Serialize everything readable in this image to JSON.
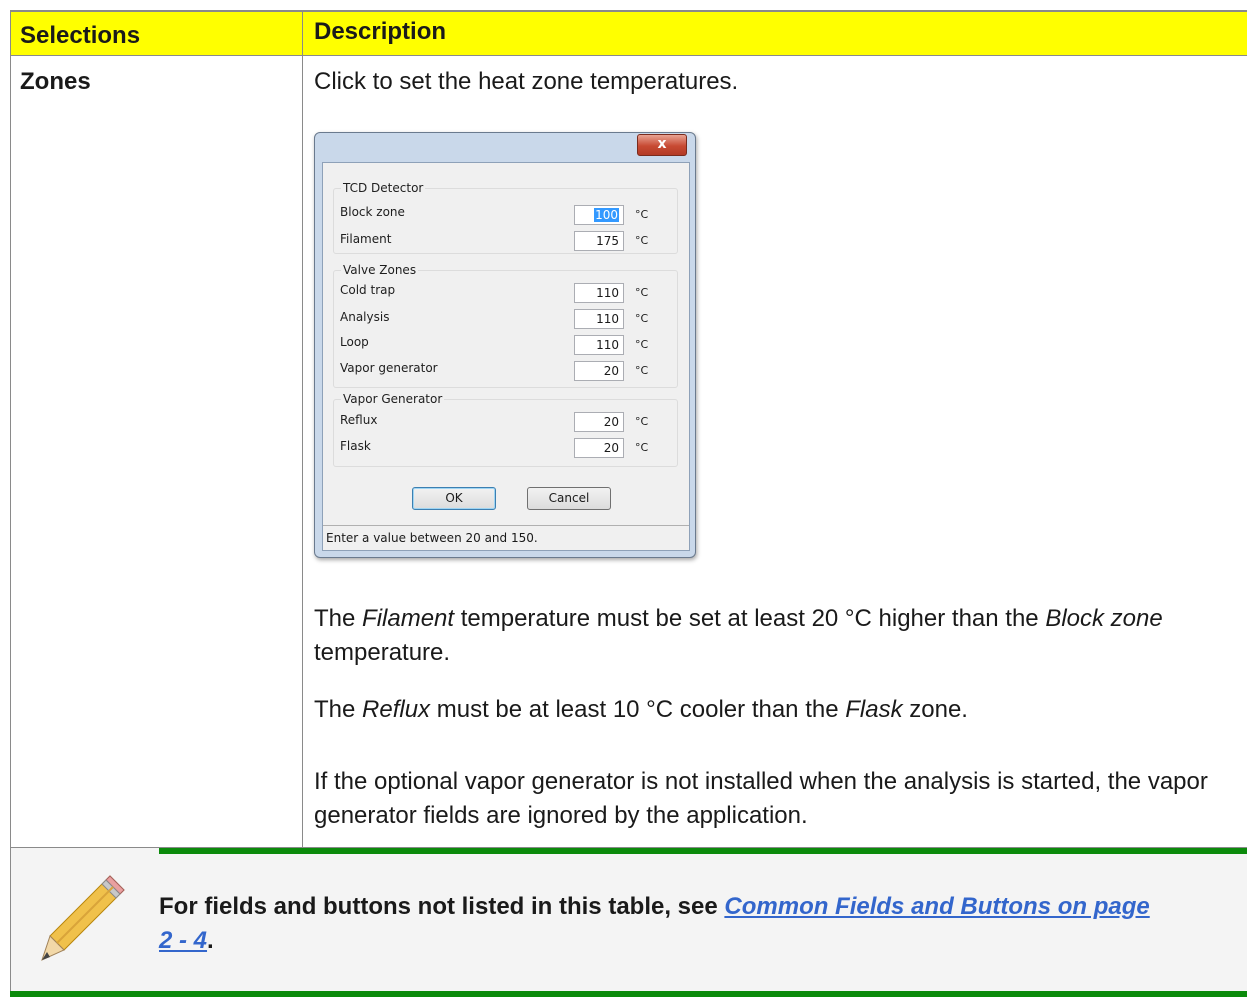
{
  "table": {
    "header_selections": "Selections",
    "header_description": "Description",
    "row_selection": "Zones",
    "row_intro": "Click to set the heat zone temperatures.",
    "para1": {
      "italic_a": "Filament",
      "text_a": " temperature must be set at least 20 °C higher than the ",
      "italic_b": "Block zone",
      "text_b": " temperature."
    },
    "para2": {
      "text_pre": "The ",
      "italic_a": "Reflux",
      "text_a": " must be at least 10 °C cooler than the ",
      "italic_b": "Flask",
      "text_b": " zone."
    },
    "para3": "If the optional vapor generator is not installed when the analysis is started, the vapor generator fields are ignored by the application.",
    "para1_pre": "The "
  },
  "dialog": {
    "close_label": "x",
    "unit": "°C",
    "groups": [
      {
        "title": "TCD Detector",
        "fields": [
          {
            "label": "Block zone",
            "value": "100",
            "selected": true
          },
          {
            "label": "Filament",
            "value": "175"
          }
        ]
      },
      {
        "title": "Valve Zones",
        "fields": [
          {
            "label": "Cold trap",
            "value": "110"
          },
          {
            "label": "Analysis",
            "value": "110"
          },
          {
            "label": "Loop",
            "value": "110"
          },
          {
            "label": "Vapor generator",
            "value": "20"
          }
        ]
      },
      {
        "title": "Vapor Generator",
        "fields": [
          {
            "label": "Reflux",
            "value": "20"
          },
          {
            "label": "Flask",
            "value": "20"
          }
        ]
      }
    ],
    "ok_label": "OK",
    "cancel_label": "Cancel",
    "status_text": "Enter a value between 20 and 150."
  },
  "note": {
    "text_pre": "For fields and buttons not listed in this table, see ",
    "link_text": "Common Fields and Buttons on page 2 - 4",
    "text_post": ".",
    "icon": "pencil-icon",
    "accent_color": "#0b8a0b"
  },
  "colors": {
    "header_bg": "#ffff00",
    "link": "#3366cc"
  }
}
